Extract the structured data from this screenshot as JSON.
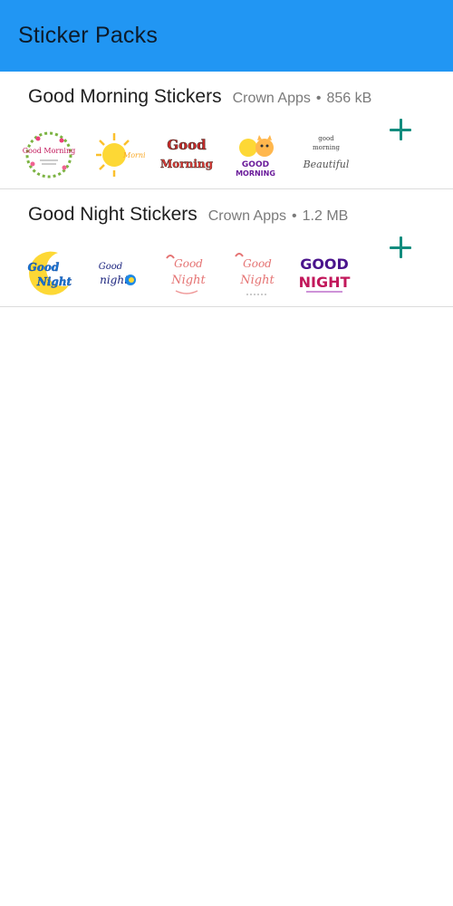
{
  "appbar": {
    "title": "Sticker Packs"
  },
  "colors": {
    "appbar": "#2196f3",
    "add_accent": "#128c7e"
  },
  "packs": [
    {
      "name": "Good Morning Stickers",
      "publisher": "Crown Apps",
      "separator": "•",
      "size": "856 kB",
      "stickers": [
        {
          "label": "Good Morning"
        },
        {
          "label": "Good Morning"
        },
        {
          "label": "Good Morning"
        },
        {
          "label": "GOOD MORNING"
        },
        {
          "label": "good morning Beautiful"
        }
      ]
    },
    {
      "name": "Good Night Stickers",
      "publisher": "Crown Apps",
      "separator": "•",
      "size": "1.2 MB",
      "stickers": [
        {
          "label": "Good Night"
        },
        {
          "label": "Good night"
        },
        {
          "label": "Good Night"
        },
        {
          "label": "Good Night"
        },
        {
          "label": "GOOD NIGHT"
        }
      ]
    }
  ]
}
